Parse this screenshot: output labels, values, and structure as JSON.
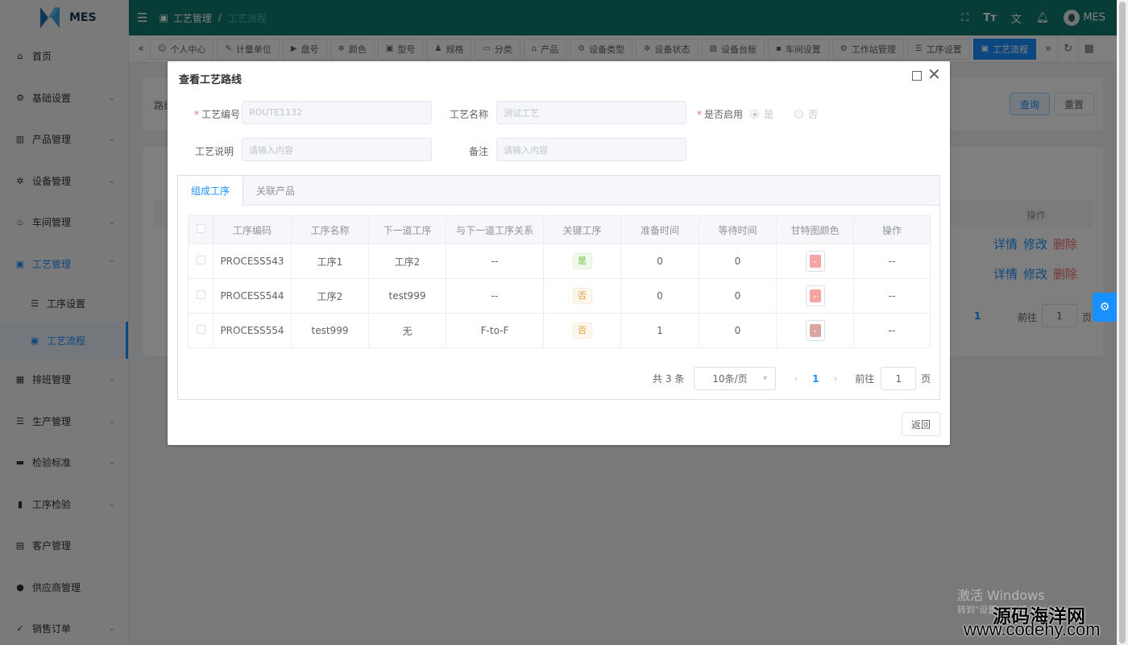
{
  "app": {
    "logo_text": "MES"
  },
  "sidebar": {
    "items": [
      {
        "label": "首页",
        "icon": "home-icon",
        "glyph": "⌂"
      },
      {
        "label": "基础设置",
        "icon": "settings-icon",
        "glyph": "⚙"
      },
      {
        "label": "产品管理",
        "icon": "chart-icon",
        "glyph": "▥"
      },
      {
        "label": "设备管理",
        "icon": "gear-icon",
        "glyph": "✲"
      },
      {
        "label": "车间管理",
        "icon": "workshop-icon",
        "glyph": "♨"
      },
      {
        "label": "工艺管理",
        "icon": "process-icon",
        "glyph": "▣"
      }
    ],
    "sub_items": [
      {
        "label": "工序设置",
        "icon": "database-icon",
        "glyph": "☰"
      },
      {
        "label": "工艺流程",
        "icon": "flow-icon",
        "glyph": "▣"
      }
    ],
    "items_after": [
      {
        "label": "排班管理",
        "icon": "calendar-icon",
        "glyph": "▦"
      },
      {
        "label": "生产管理",
        "icon": "database-icon",
        "glyph": "☰"
      },
      {
        "label": "检验标准",
        "icon": "monitor-icon",
        "glyph": "▬"
      },
      {
        "label": "工序检验",
        "icon": "book-icon",
        "glyph": "▮"
      },
      {
        "label": "客户管理",
        "icon": "contact-icon",
        "glyph": "▤"
      },
      {
        "label": "供应商管理",
        "icon": "user-icon",
        "glyph": "●"
      },
      {
        "label": "销售订单",
        "icon": "order-icon",
        "glyph": "✓"
      }
    ]
  },
  "header": {
    "breadcrumb_root": "工艺管理",
    "breadcrumb_current": "工艺流程",
    "user_name": "MES"
  },
  "tags": [
    {
      "label": "个人中心",
      "glyph": "☺"
    },
    {
      "label": "计量单位",
      "glyph": "✎"
    },
    {
      "label": "盘号",
      "glyph": "▶"
    },
    {
      "label": "颜色",
      "glyph": "✲"
    },
    {
      "label": "型号",
      "glyph": "▣"
    },
    {
      "label": "规格",
      "glyph": "♟"
    },
    {
      "label": "分类",
      "glyph": "▭"
    },
    {
      "label": "产品",
      "glyph": "⌂"
    },
    {
      "label": "设备类型",
      "glyph": "⚙"
    },
    {
      "label": "设备状态",
      "glyph": "✲"
    },
    {
      "label": "设备台账",
      "glyph": "▧"
    },
    {
      "label": "车间设置",
      "glyph": "▪"
    },
    {
      "label": "工作站管理",
      "glyph": "⚙"
    },
    {
      "label": "工序设置",
      "glyph": "☰"
    },
    {
      "label": "工艺流程",
      "glyph": "▣"
    }
  ],
  "background": {
    "search_label": "查询",
    "reset_label": "重置",
    "route_label": "路线",
    "op_header": "操作",
    "detail": "详情",
    "edit": "修改",
    "delete": "删除",
    "page_current": "1",
    "goto_label": "前往",
    "goto_value": "1",
    "page_suffix": "页"
  },
  "dialog": {
    "title": "查看工艺路线",
    "fields": {
      "code_label": "工艺编号",
      "code_value": "ROUTE1132",
      "name_label": "工艺名称",
      "name_value": "测试工艺",
      "enabled_label": "是否启用",
      "enabled_yes": "是",
      "enabled_no": "否",
      "desc_label": "工艺说明",
      "desc_placeholder": "请输入内容",
      "remark_label": "备注",
      "remark_placeholder": "请输入内容"
    },
    "tabs": [
      "组成工序",
      "关联产品"
    ],
    "table": {
      "columns": [
        "工序编码",
        "工序名称",
        "下一道工序",
        "与下一道工序关系",
        "关键工序",
        "准备时间",
        "等待时间",
        "甘特图颜色",
        "操作"
      ],
      "rows": [
        {
          "code": "PROCESS543",
          "name": "工序1",
          "next": "工序2",
          "relation": "--",
          "key": "是",
          "prep": "0",
          "wait": "0",
          "color": "#f5a3a3",
          "op": "--"
        },
        {
          "code": "PROCESS544",
          "name": "工序2",
          "next": "test999",
          "relation": "--",
          "key": "否",
          "prep": "0",
          "wait": "0",
          "color": "#f5a3a3",
          "op": "--"
        },
        {
          "code": "PROCESS554",
          "name": "test999",
          "next": "无",
          "relation": "F-to-F",
          "key": "否",
          "prep": "1",
          "wait": "0",
          "color": "#d9a4a4",
          "op": "--"
        }
      ]
    },
    "pagination": {
      "total_text": "共 3 条",
      "page_size": "10条/页",
      "current": "1",
      "goto_label": "前往",
      "goto_value": "1",
      "page_suffix": "页"
    },
    "back_label": "返回"
  },
  "watermark": {
    "line1": "激活 Windows",
    "line2": "转到\"设置\"以激活 Windows。",
    "site_cn": "源码海洋网",
    "site_url": "www.codehy.com"
  },
  "colors": {
    "header_bg": "#0f7b6c",
    "primary": "#1890ff",
    "danger": "#f56c6c"
  }
}
